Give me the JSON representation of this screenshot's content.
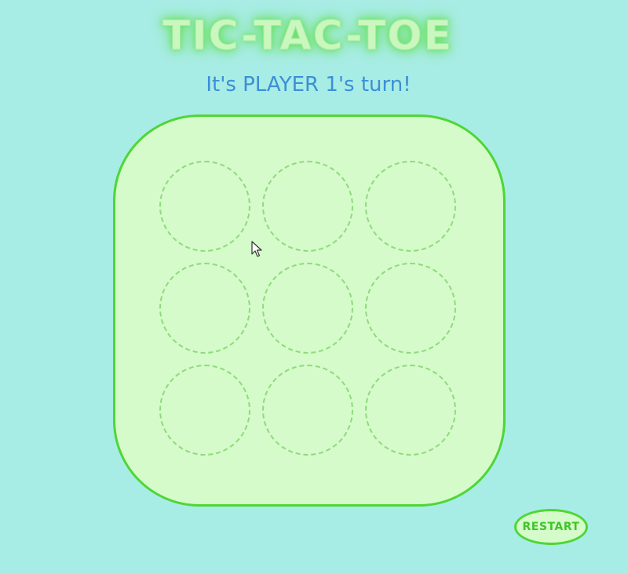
{
  "game": {
    "title": "TIC-TAC-TOE",
    "turn_message": "It's PLAYER 1's turn!",
    "board": {
      "cells": [
        "",
        "",
        "",
        "",
        "",
        "",
        "",
        "",
        ""
      ]
    },
    "restart_label": "RESTART"
  },
  "colors": {
    "background": "#a8ece6",
    "board_fill": "#d5fbca",
    "board_border": "#4fd636",
    "cell_border": "#8fdb7d",
    "title": "#c9f7be",
    "turn_text": "#3a8fd6",
    "restart_text": "#3fc428"
  },
  "icons": {
    "cursor": "mouse-pointer-icon"
  }
}
